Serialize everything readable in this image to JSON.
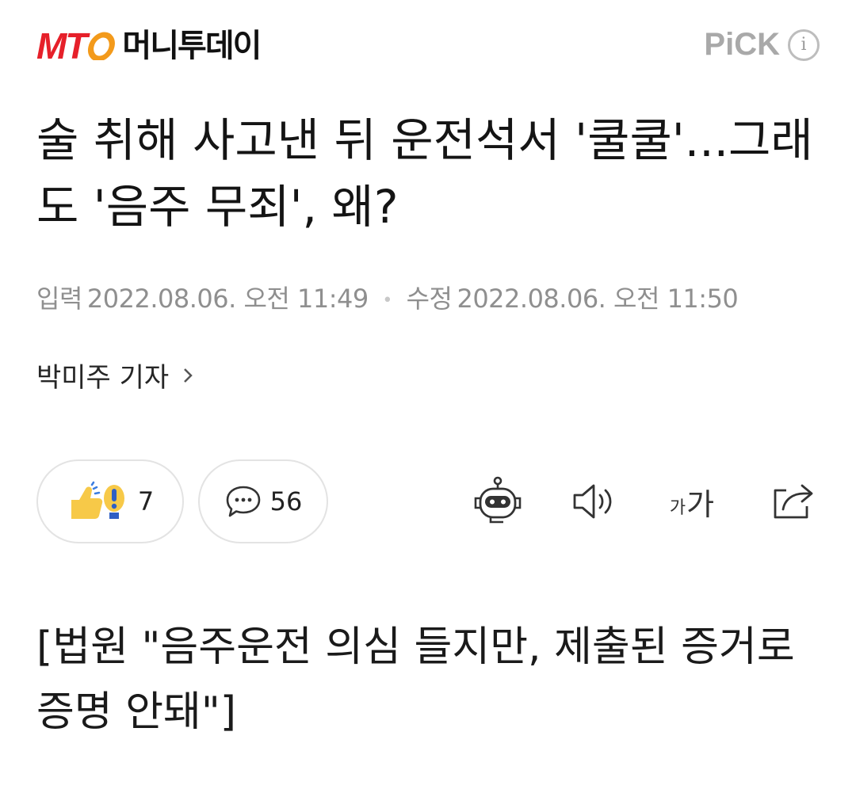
{
  "header": {
    "logo_mark": "MT",
    "logo_name": "머니투데이",
    "pick_label": "PiCK",
    "info_icon": "info-icon",
    "brand_color": "#e6202a"
  },
  "article": {
    "title": "술 취해 사고낸 뒤 운전석서 '쿨쿨'...그래도 '음주 무죄', 왜?",
    "input_label": "입력",
    "input_datetime": "2022.08.06. 오전 11:49",
    "modified_label": "수정",
    "modified_datetime": "2022.08.06. 오전 11:50",
    "reporter": "박미주 기자",
    "subtitle": "[법원 \"음주운전 의심 들지만, 제출된 증거로 증명 안돼\"]"
  },
  "actions": {
    "reaction_count": "7",
    "comment_count": "56",
    "font_small": "가",
    "font_big": "가",
    "icons": [
      "reaction-icon",
      "comment-icon",
      "summary-bot-icon",
      "speaker-icon",
      "font-size-icon",
      "share-icon"
    ]
  }
}
